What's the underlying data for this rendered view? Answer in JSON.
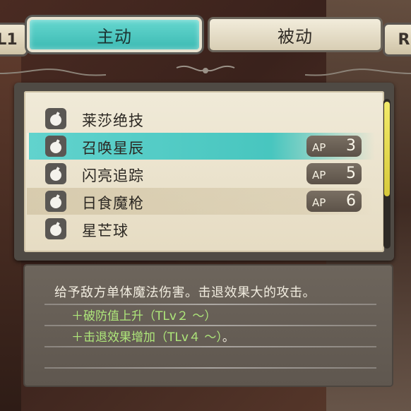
{
  "tabs": {
    "left_shoulder": "L1",
    "right_shoulder": "R",
    "active_label": "主动",
    "inactive_label": "被动"
  },
  "skills": [
    {
      "name": "莱莎绝技",
      "icon": "bomb-icon",
      "ap_label": "",
      "ap": "",
      "state": "normal"
    },
    {
      "name": "召唤星辰",
      "icon": "bomb-icon",
      "ap_label": "AP",
      "ap": "3",
      "state": "selected"
    },
    {
      "name": "闪亮追踪",
      "icon": "bomb-icon",
      "ap_label": "AP",
      "ap": "5",
      "state": "normal"
    },
    {
      "name": "日食魔枪",
      "icon": "bomb-icon",
      "ap_label": "AP",
      "ap": "6",
      "state": "dim"
    },
    {
      "name": "星芒球",
      "icon": "bomb-icon",
      "ap_label": "",
      "ap": "",
      "state": "normal"
    }
  ],
  "description": {
    "text": "给予敌方单体魔法伤害。击退效果大的攻击。",
    "bonus_1": "＋破防值上升（TLv２ ～）",
    "bonus_2": "＋击退效果增加（TLv４ ～）",
    "bonus_2_tail": "。"
  },
  "colors": {
    "accent_teal": "#3bbab3",
    "bonus_green": "#aee77a",
    "scroll_yellow": "#e3d750"
  }
}
